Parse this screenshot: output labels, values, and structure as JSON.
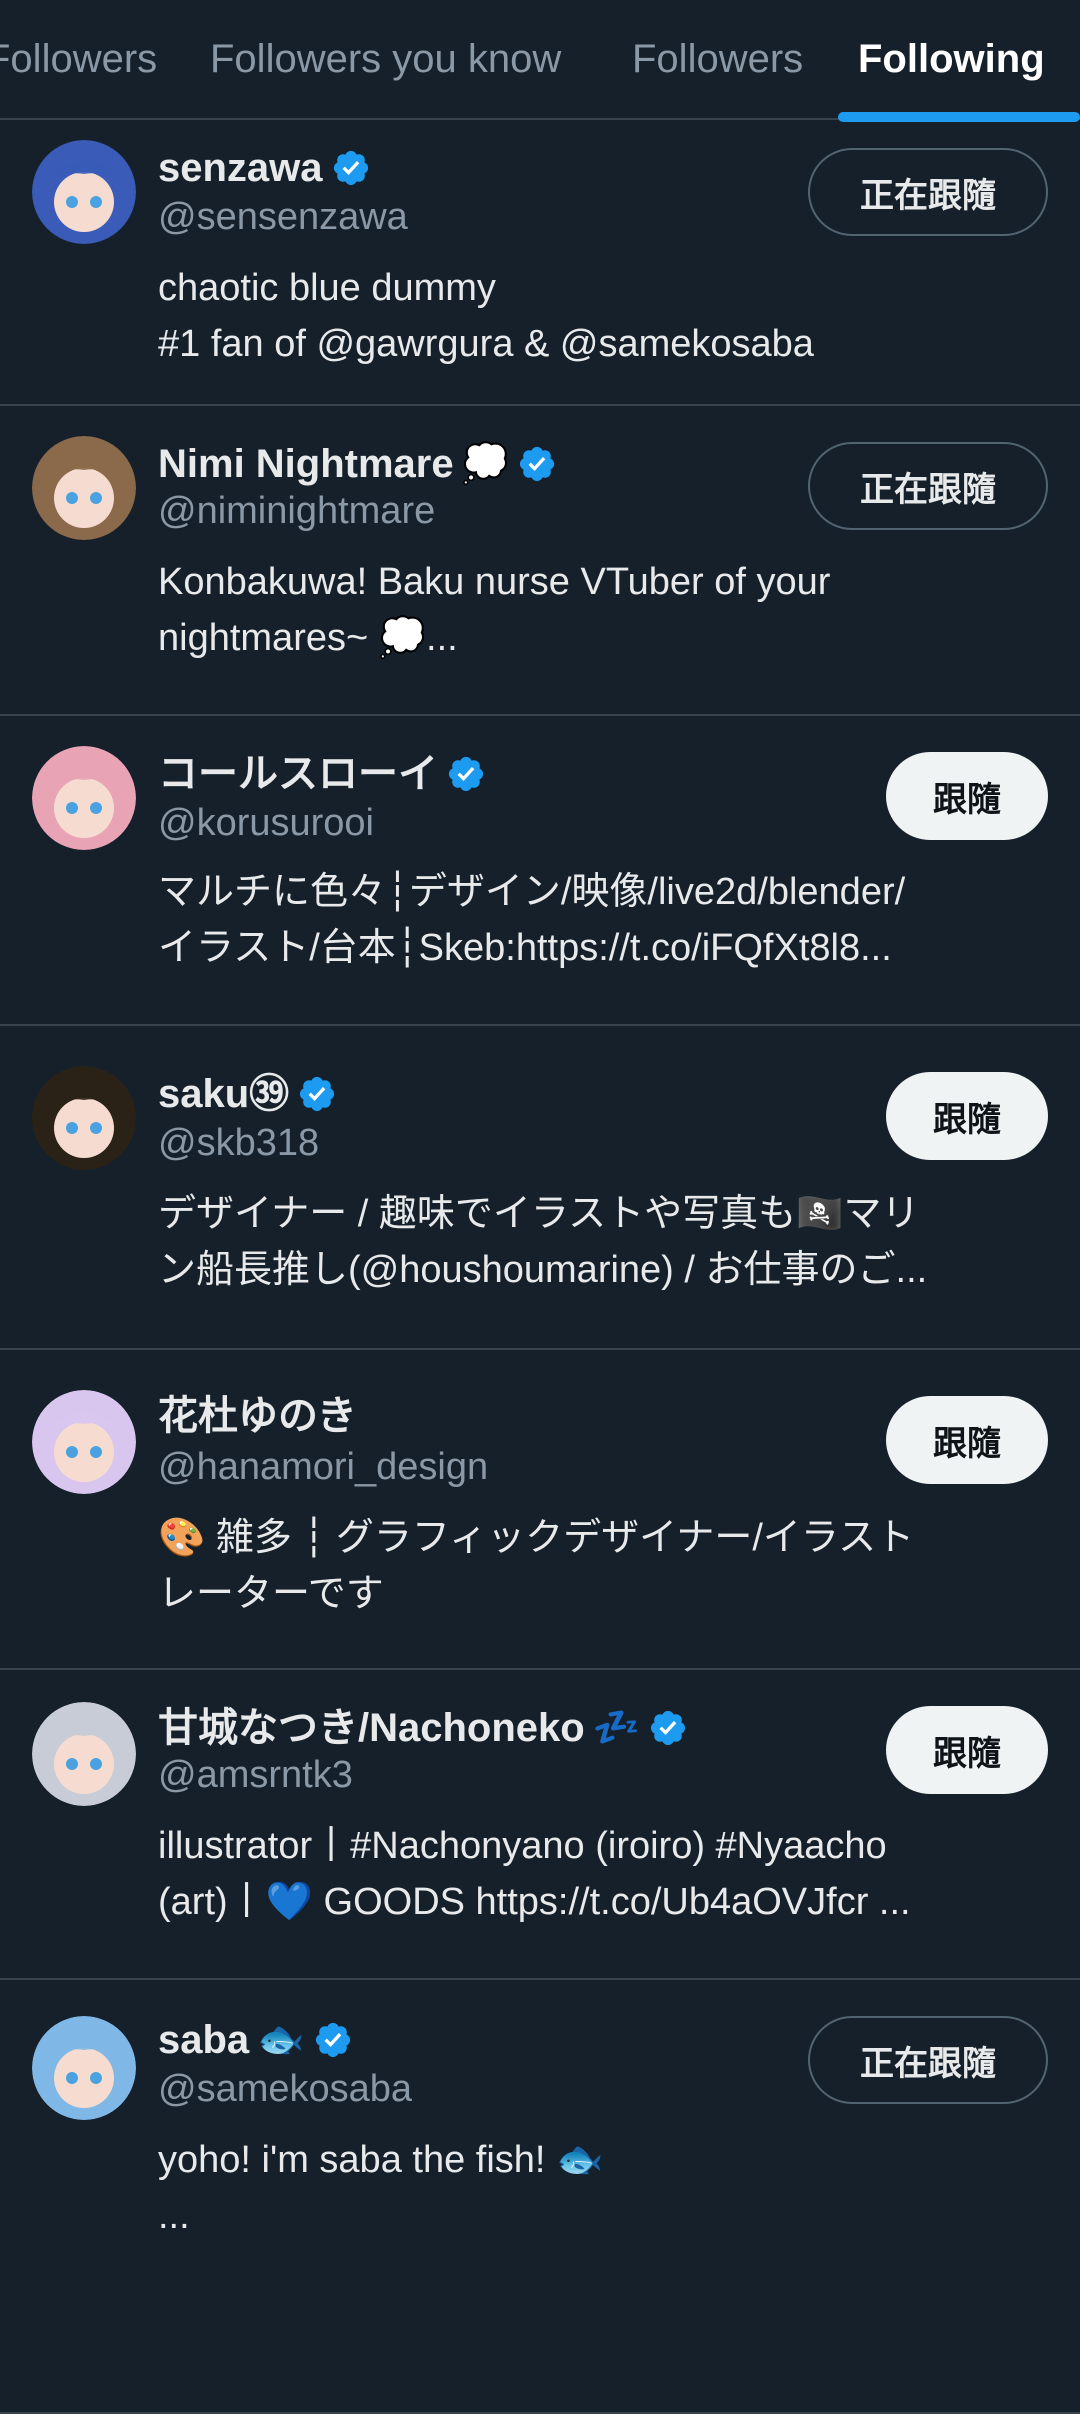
{
  "tabs": [
    {
      "label": "Followers"
    },
    {
      "label": "Followers you know"
    },
    {
      "label": "Followers"
    },
    {
      "label": "Following"
    }
  ],
  "accounts": [
    {
      "name": "senzawa",
      "emoji": "",
      "verified": true,
      "handle": "@sensenzawa",
      "bio": "chaotic blue dummy\n#1 fan of @gawrgura & @samekosaba",
      "button": "正在跟隨",
      "button_state": "following",
      "avatar_color": "#3a5bb8"
    },
    {
      "name": "Nimi Nightmare",
      "emoji": "💭",
      "verified": true,
      "handle": "@niminightmare",
      "bio": "Konbakuwa! Baku nurse VTuber of your\nnightmares~ 💭...",
      "button": "正在跟隨",
      "button_state": "following",
      "avatar_color": "#8a6a4a"
    },
    {
      "name": "コールスローイ",
      "emoji": "",
      "verified": true,
      "handle": "@korusurooi",
      "bio": "マルチに色々┆デザイン/映像/live2d/blender/\nイラスト/台本┆Skeb:https://t.co/iFQfXt8l8...",
      "button": "跟隨",
      "button_state": "follow",
      "avatar_color": "#e8a3b5"
    },
    {
      "name": "saku㊴",
      "emoji": "",
      "verified": true,
      "handle": "@skb318",
      "bio": "デザイナー / 趣味でイラストや写真も🏴‍☠️マリ\nン船長推し(@houshoumarine) / お仕事のご...",
      "button": "跟隨",
      "button_state": "follow",
      "avatar_color": "#2a2216"
    },
    {
      "name": "花杜ゆのき",
      "emoji": "",
      "verified": false,
      "handle": "@hanamori_design",
      "bio": "🎨 雑多 ┆ グラフィックデザイナー/イラスト\nレーターです",
      "button": "跟隨",
      "button_state": "follow",
      "avatar_color": "#d9c6ee"
    },
    {
      "name": "甘城なつき/Nachoneko",
      "emoji": "💤",
      "verified": true,
      "handle": "@amsrntk3",
      "bio": "illustrator丨#Nachonyano (iroiro) #Nyaacho\n(art)丨💙 GOODS https://t.co/Ub4aOVJfcr ...",
      "button": "跟隨",
      "button_state": "follow",
      "avatar_color": "#c7ccd6"
    },
    {
      "name": "saba",
      "emoji": "🐟",
      "verified": true,
      "handle": "@samekosaba",
      "bio": "yoho! i'm saba the fish! 🐟\n...",
      "button": "正在跟隨",
      "button_state": "following",
      "avatar_color": "#7fb8e6"
    }
  ],
  "colors": {
    "background": "#15202b",
    "accent": "#1d9bf0",
    "divider": "#38444d",
    "secondary_text": "#8b98a5"
  }
}
